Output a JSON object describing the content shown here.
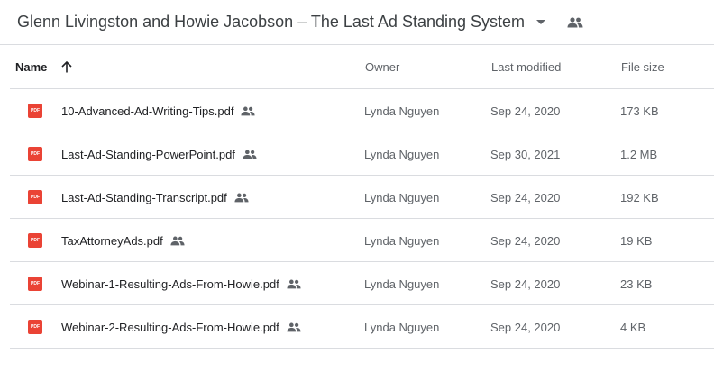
{
  "header": {
    "title": "Glenn Livingston and Howie Jacobson – The Last Ad Standing System",
    "dropdown_icon": "chevron-down-icon",
    "shared_icon": "people-icon"
  },
  "columns": {
    "name": "Name",
    "owner": "Owner",
    "last_modified": "Last modified",
    "file_size": "File size",
    "sort_icon": "arrow-up-icon"
  },
  "files": [
    {
      "name": "10-Advanced-Ad-Writing-Tips.pdf",
      "type_badge": "PDF",
      "owner": "Lynda Nguyen",
      "modified": "Sep 24, 2020",
      "size": "173 KB"
    },
    {
      "name": "Last-Ad-Standing-PowerPoint.pdf",
      "type_badge": "PDF",
      "owner": "Lynda Nguyen",
      "modified": "Sep 30, 2021",
      "size": "1.2 MB"
    },
    {
      "name": "Last-Ad-Standing-Transcript.pdf",
      "type_badge": "PDF",
      "owner": "Lynda Nguyen",
      "modified": "Sep 24, 2020",
      "size": "192 KB"
    },
    {
      "name": "TaxAttorneyAds.pdf",
      "type_badge": "PDF",
      "owner": "Lynda Nguyen",
      "modified": "Sep 24, 2020",
      "size": "19 KB"
    },
    {
      "name": "Webinar-1-Resulting-Ads-From-Howie.pdf",
      "type_badge": "PDF",
      "owner": "Lynda Nguyen",
      "modified": "Sep 24, 2020",
      "size": "23 KB"
    },
    {
      "name": "Webinar-2-Resulting-Ads-From-Howie.pdf",
      "type_badge": "PDF",
      "owner": "Lynda Nguyen",
      "modified": "Sep 24, 2020",
      "size": "4 KB"
    }
  ],
  "colors": {
    "pdf_red": "#ea4335",
    "text_primary": "#202124",
    "text_secondary": "#5f6368",
    "divider": "#dadce0"
  }
}
